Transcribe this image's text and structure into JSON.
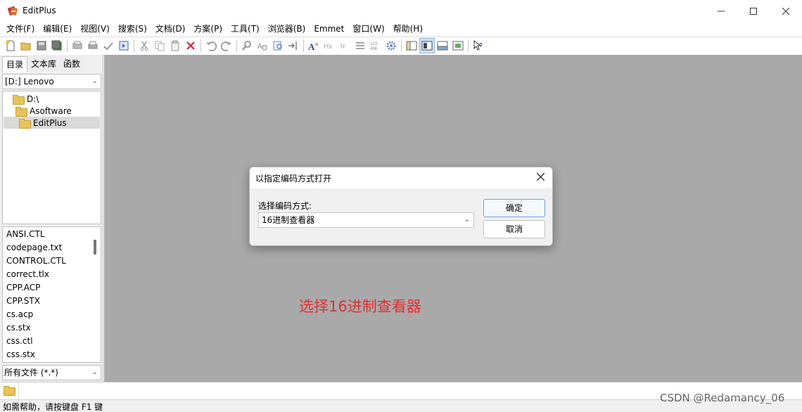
{
  "window": {
    "title": "EditPlus"
  },
  "menu": [
    "文件(F)",
    "编辑(E)",
    "视图(V)",
    "搜索(S)",
    "文档(D)",
    "方案(P)",
    "工具(T)",
    "浏览器(B)",
    "Emmet",
    "窗口(W)",
    "帮助(H)"
  ],
  "toolbar_icons": [
    "new-file-icon",
    "open-folder-icon",
    "save-icon",
    "save-all-icon",
    "print-preview-icon",
    "print-icon",
    "spell-check-icon",
    "browser-view-icon",
    "cut-icon",
    "copy-icon",
    "paste-icon",
    "delete-icon",
    "undo-icon",
    "redo-icon",
    "find-icon",
    "replace-icon",
    "find-in-files-icon",
    "goto-line-icon",
    "font-icon",
    "hex-icon",
    "word-wrap-icon",
    "line-spacing-icon",
    "line-number-icon",
    "settings-gear-icon",
    "pane-toggle-icon",
    "dual-pane-icon",
    "output-window-icon",
    "clip-window-icon",
    "help-cursor-icon"
  ],
  "left_panel": {
    "tabs": [
      "目录",
      "文本库",
      "函数"
    ],
    "drive": "[D:] Lenovo",
    "tree": [
      {
        "label": "D:\\",
        "indent": 0
      },
      {
        "label": "Asoftware",
        "indent": 1
      },
      {
        "label": "EditPlus",
        "indent": 2,
        "selected": true
      }
    ],
    "files": [
      "ANSI.CTL",
      "codepage.txt",
      "CONTROL.CTL",
      "correct.tlx",
      "CPP.ACP",
      "CPP.STX",
      "cs.acp",
      "cs.stx",
      "css.ctl",
      "css.stx"
    ],
    "filter": "所有文件 (*.*)"
  },
  "dialog": {
    "title": "以指定编码方式打开",
    "label": "选择编码方式:",
    "selected_encoding": "16进制查看器",
    "ok_label": "确定",
    "cancel_label": "取消"
  },
  "annotation": "选择16进制查看器",
  "status": {
    "text": "如需帮助，请按键盘 F1 键"
  },
  "watermark": "CSDN @Redamancy_06",
  "colors": {
    "annotation": "#e03030",
    "workspace": "#a9a9a9",
    "accent": "#6ea2d8"
  }
}
